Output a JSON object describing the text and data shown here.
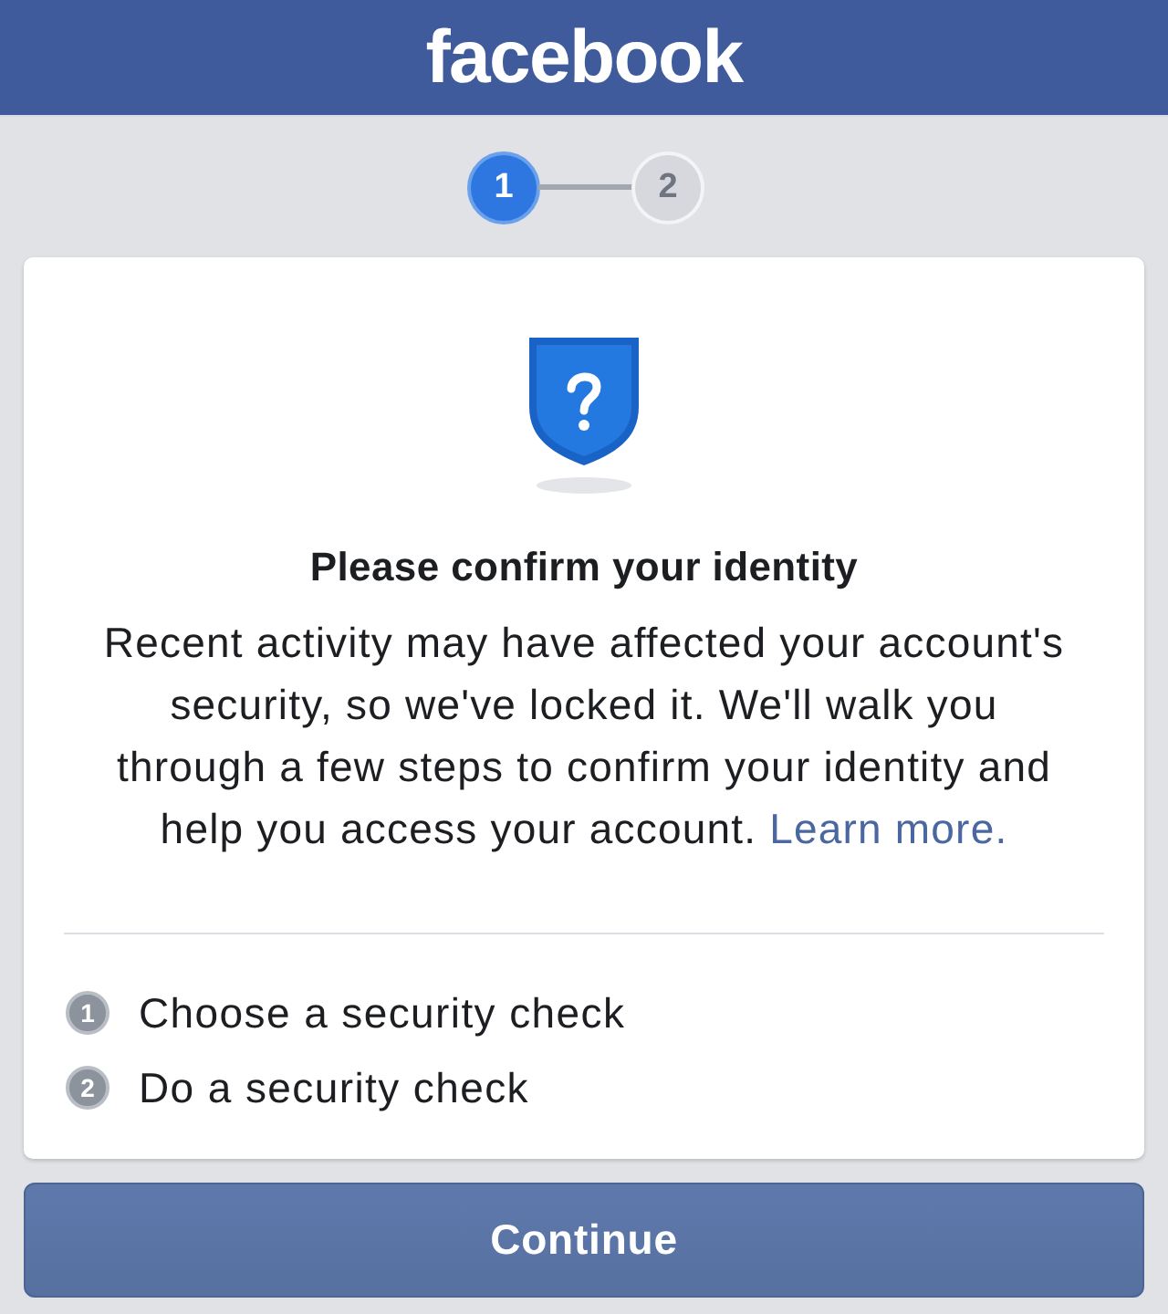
{
  "header": {
    "logo": "facebook"
  },
  "stepper": {
    "steps": [
      {
        "label": "1",
        "active": true
      },
      {
        "label": "2",
        "active": false
      }
    ]
  },
  "card": {
    "title": "Please confirm your identity",
    "body": "Recent activity may have affected your account's security, so we've locked it. We'll walk you through a few steps to confirm your identity and help you access your account.",
    "link": "Learn more.",
    "steps": [
      {
        "number": "1",
        "label": "Choose a security check"
      },
      {
        "number": "2",
        "label": "Do a security check"
      }
    ]
  },
  "continue_button": "Continue"
}
